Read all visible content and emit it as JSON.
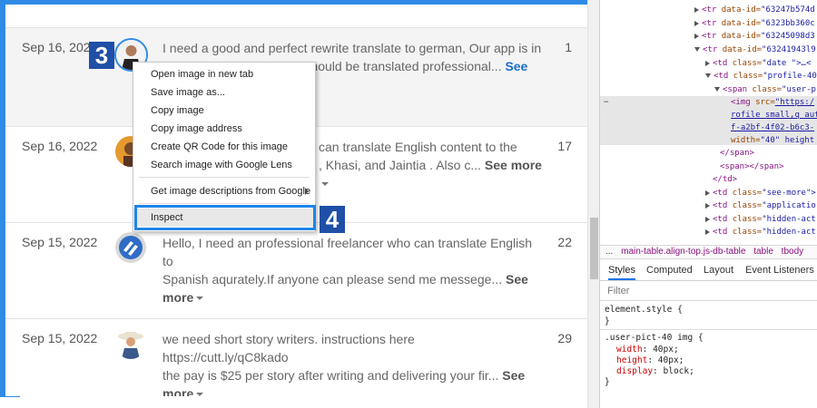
{
  "rows": [
    {
      "date": "Sep 16, 2022",
      "line1": "I need a good and perfect rewrite translate to german, Our app is in",
      "line2": "English, so every screen should be translated professional...",
      "more": "See more",
      "count": "1"
    },
    {
      "date": "Sep 16, 2022",
      "line1": "can translate English content to the",
      "line2": ", Khasi, and Jaintia . Also c...",
      "more": "See more",
      "count": "17"
    },
    {
      "date": "Sep 15, 2022",
      "line1": "Hello, I need an professional freelancer who can translate English to",
      "line2": "Spanish aqurately.If anyone can please send me messege...",
      "more": "See more",
      "count": "22"
    },
    {
      "date": "Sep 15, 2022",
      "line1": "we need short story writers. instructions here https://cutt.ly/qC8kado",
      "line2": "the pay is $25 per story after writing and delivering your fir...",
      "more": "See more",
      "count": "29"
    }
  ],
  "context_menu": {
    "items": [
      "Open image in new tab",
      "Save image as...",
      "Copy image",
      "Copy image address",
      "Create QR Code for this image",
      "Search image with Google Lens",
      "Get image descriptions from Google",
      "Inspect"
    ]
  },
  "steps": {
    "step3": "3",
    "step4": "4"
  },
  "devtools": {
    "dom_lines": [
      {
        "tag": "<tr ",
        "attr": "data-id=",
        "val": "\"63247b574d"
      },
      {
        "tag": "<tr ",
        "attr": "data-id=",
        "val": "\"6323bb360c"
      },
      {
        "tag": "<tr ",
        "attr": "data-id=",
        "val": "\"63245098d3"
      },
      {
        "tag": "<tr ",
        "attr": "data-id=",
        "val": "\"63241943l9"
      },
      {
        "tag": "<td ",
        "attr": "class=",
        "val": "\"date  \">…<"
      },
      {
        "tag": "<td ",
        "attr": "class=",
        "val": "\"profile-40"
      },
      {
        "tag": "<span ",
        "attr": "class=",
        "val": "\"user-p"
      },
      {
        "tag": "<img ",
        "attr": "src=",
        "val": "\"https:/"
      },
      {
        "tag": "",
        "attr": "",
        "val": "rofile small,q aut"
      },
      {
        "tag": "",
        "attr": "",
        "val": "f-a2bf-4f02-b6c3-"
      },
      {
        "tag": "",
        "attr": "width=",
        "val": "\"40\" height"
      },
      {
        "tag": "</span>",
        "attr": "",
        "val": ""
      },
      {
        "tag": "<span></span>",
        "attr": "",
        "val": ""
      },
      {
        "tag": "</td>",
        "attr": "",
        "val": ""
      },
      {
        "tag": "<td ",
        "attr": "class=",
        "val": "\"see-more\">"
      },
      {
        "tag": "<td ",
        "attr": "class=",
        "val": "\"applicatio"
      },
      {
        "tag": "<td ",
        "attr": "class=",
        "val": "\"hidden-act"
      },
      {
        "tag": "<td ",
        "attr": "class=",
        "val": "\"hidden-act"
      }
    ],
    "breadcrumb": [
      "...",
      "main-table.align-top.js-db-table",
      "table",
      "tbody"
    ],
    "tabs": [
      "Styles",
      "Computed",
      "Layout",
      "Event Listeners"
    ],
    "filter_placeholder": "Filter",
    "css": {
      "element_style": "element.style {",
      "close": "}",
      "rule_selector": ".user-pict-40 img {",
      "props": [
        {
          "name": "width",
          "value": "40px;"
        },
        {
          "name": "height",
          "value": "40px;"
        },
        {
          "name": "display",
          "value": "block;"
        }
      ]
    }
  },
  "colors": {
    "accent": "#1f84e8",
    "badge": "#1f4fa6",
    "link": "#1a6fc9"
  }
}
